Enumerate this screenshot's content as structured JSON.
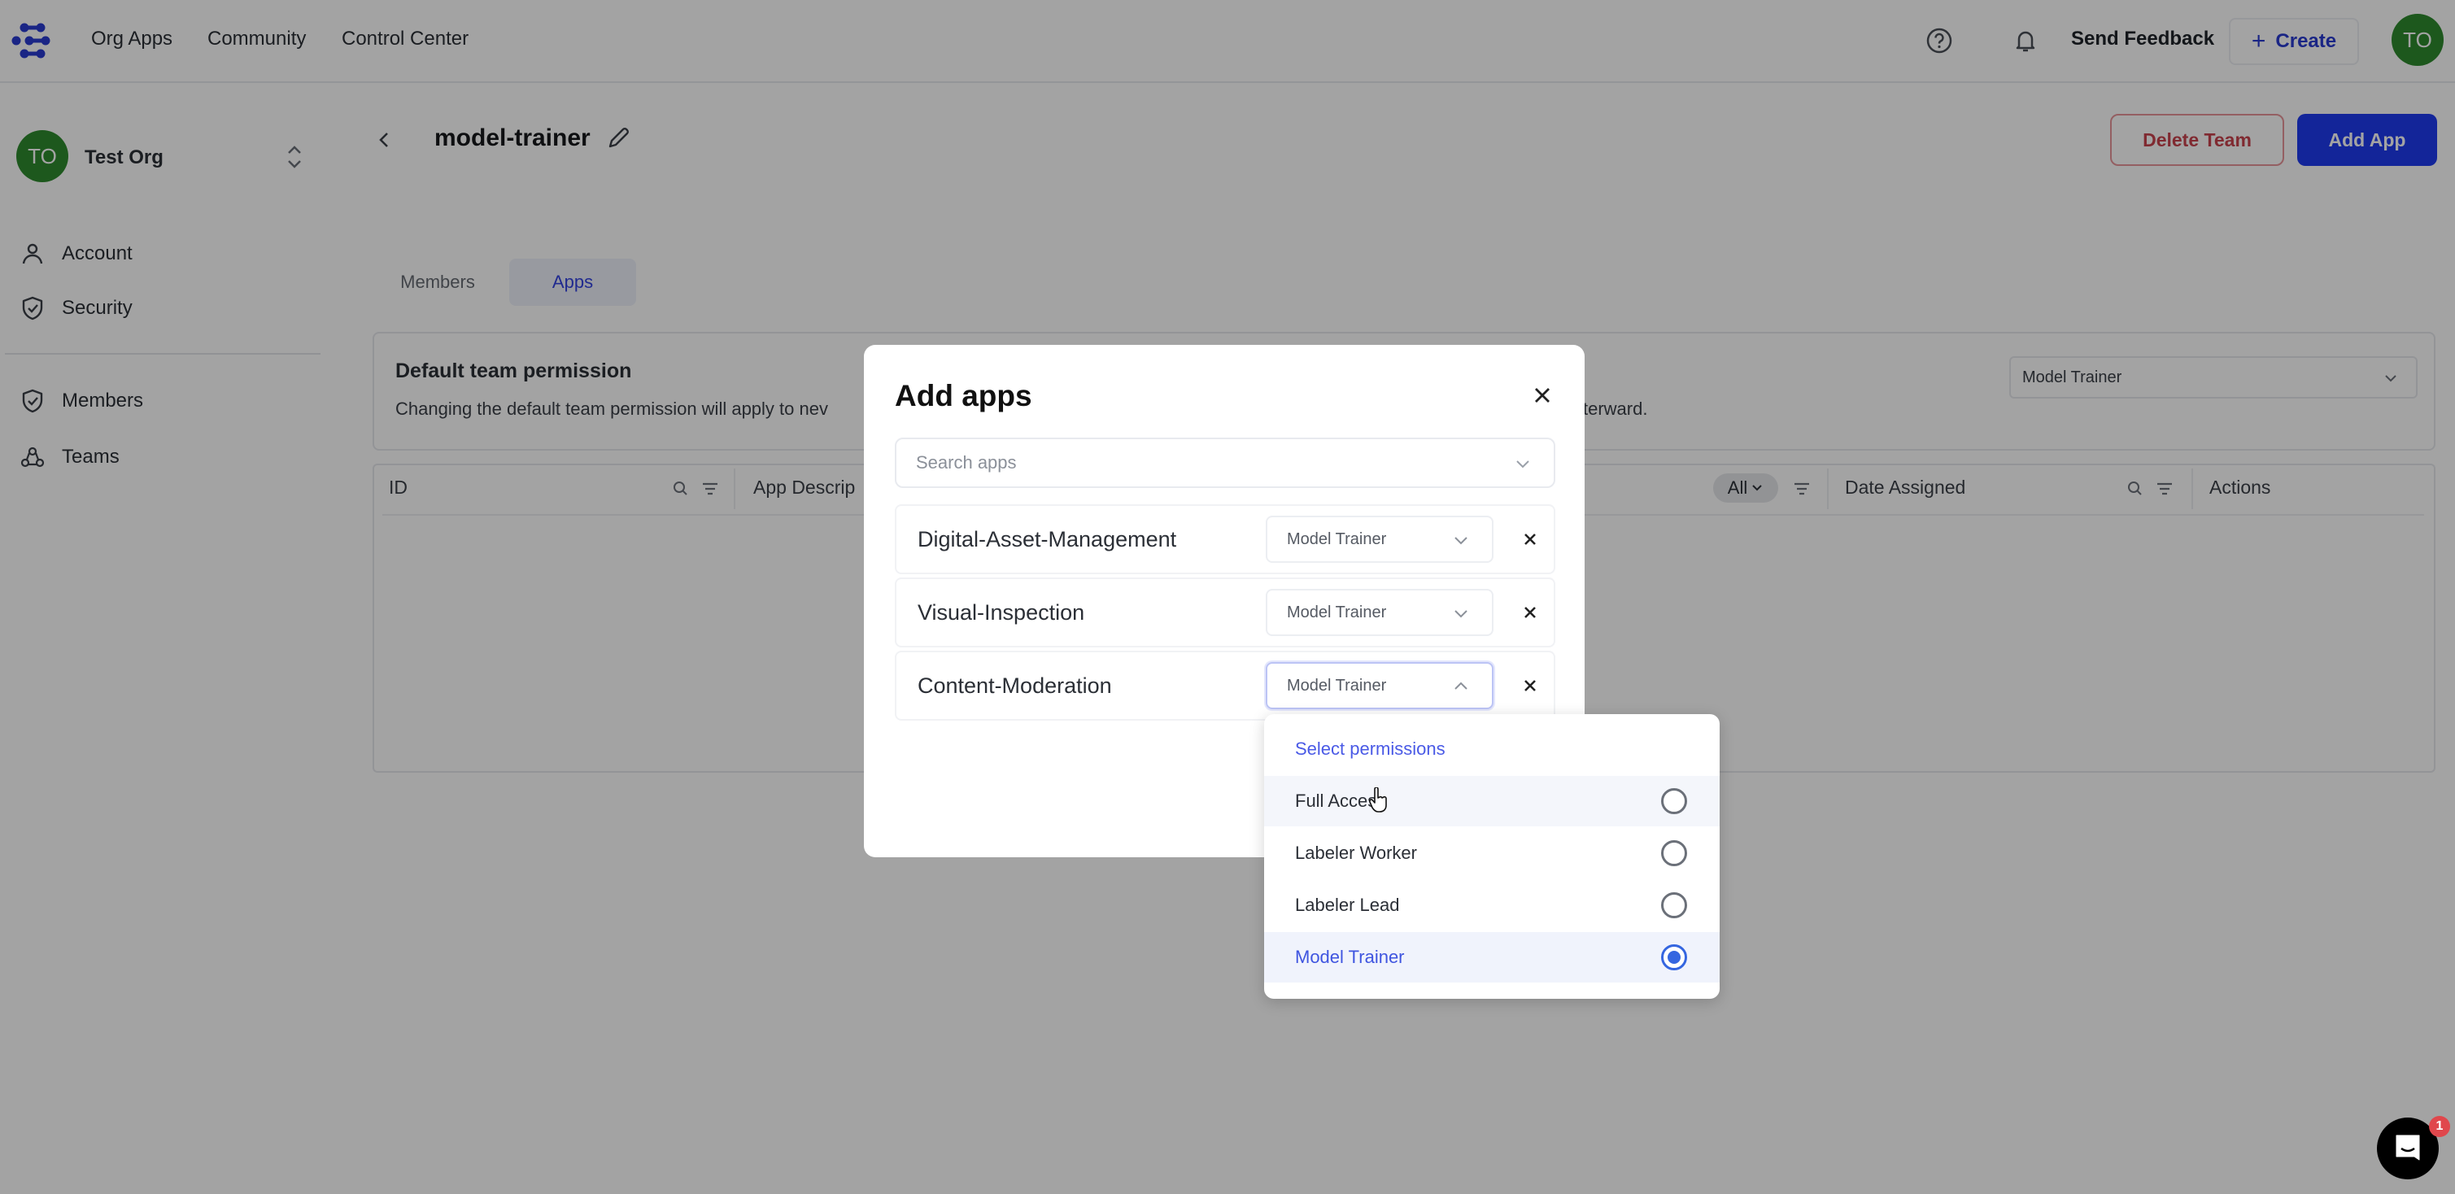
{
  "topbar": {
    "nav": [
      "Org Apps",
      "Community",
      "Control Center"
    ],
    "send_feedback": "Send Feedback",
    "create_label": "Create",
    "user_initials": "TO",
    "brand_color": "#2a3bd0"
  },
  "sidebar": {
    "org_initials": "TO",
    "org_name": "Test Org",
    "items": [
      {
        "label": "Account",
        "icon": "user-icon"
      },
      {
        "label": "Security",
        "icon": "shield-check-icon"
      },
      {
        "label": "Members",
        "icon": "shield-check-icon"
      },
      {
        "label": "Teams",
        "icon": "team-icon"
      }
    ]
  },
  "page": {
    "team_name": "model-trainer",
    "delete_team_label": "Delete Team",
    "add_app_label": "Add App",
    "tabs": [
      {
        "label": "Members",
        "active": false
      },
      {
        "label": "Apps",
        "active": true
      }
    ],
    "default_permission": {
      "title": "Default team permission",
      "description": "Changing the default team permission will apply to nev",
      "description_tail": "terward.",
      "value": "Model Trainer"
    },
    "table": {
      "columns": [
        "ID",
        "App Descrip",
        "Date Assigned",
        "Actions"
      ],
      "filter_value": "All",
      "rows": []
    }
  },
  "modal": {
    "title": "Add apps",
    "search_placeholder": "Search apps",
    "apps": [
      {
        "name": "Digital-Asset-Management",
        "permission": "Model Trainer",
        "open": false
      },
      {
        "name": "Visual-Inspection",
        "permission": "Model Trainer",
        "open": false
      },
      {
        "name": "Content-Moderation",
        "permission": "Model Trainer",
        "open": true
      }
    ]
  },
  "permission_dropdown": {
    "header": "Select permissions",
    "options": [
      {
        "label": "Full Access",
        "selected": false,
        "hovered": true
      },
      {
        "label": "Labeler Worker",
        "selected": false,
        "hovered": false
      },
      {
        "label": "Labeler Lead",
        "selected": false,
        "hovered": false
      },
      {
        "label": "Model Trainer",
        "selected": true,
        "hovered": false
      }
    ]
  },
  "chat": {
    "badge_count": "1"
  }
}
